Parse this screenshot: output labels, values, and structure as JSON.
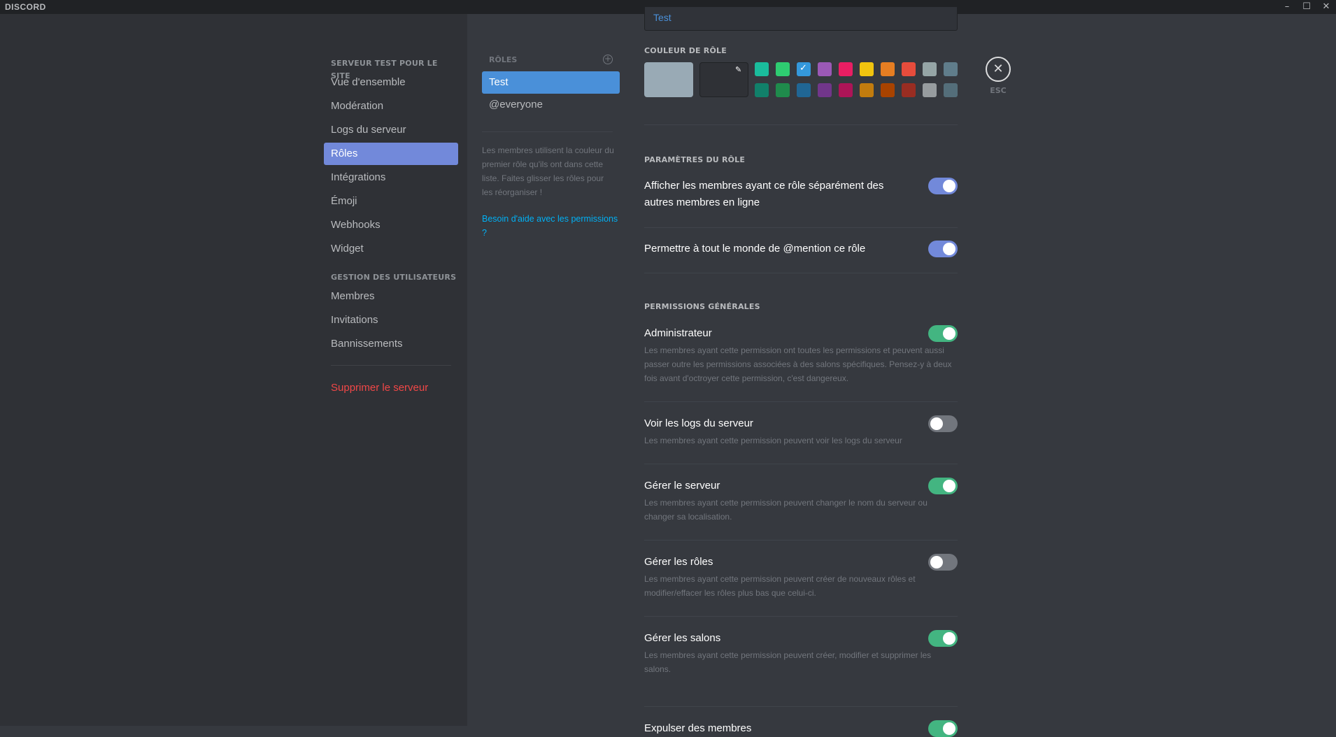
{
  "titlebar": {
    "logo": "DISCORD",
    "min": "–",
    "max": "☐",
    "close": "✕"
  },
  "sidebar": {
    "server_header": "SERVEUR TEST POUR LE SITE",
    "server_items": [
      "Vue d'ensemble",
      "Modération",
      "Logs du serveur",
      "Rôles",
      "Intégrations",
      "Émoji",
      "Webhooks",
      "Widget"
    ],
    "users_header": "GESTION DES UTILISATEURS",
    "user_items": [
      "Membres",
      "Invitations",
      "Bannissements"
    ],
    "delete_label": "Supprimer le serveur"
  },
  "roles": {
    "header": "RÔLES",
    "add_icon": "+",
    "items": [
      "Test",
      "@everyone"
    ],
    "note": "Les membres utilisent la couleur du premier rôle qu'ils ont dans cette liste. Faites glisser les rôles pour les réorganiser !",
    "help_link": "Besoin d'aide avec les permissions ?"
  },
  "main": {
    "role_name": "Test",
    "color_title": "COULEUR DE RÔLE",
    "default_color": "#99aab5",
    "swatch_row_1": [
      "#1abc9c",
      "#2ecc71",
      "#3498db",
      "#9b59b6",
      "#e91e63",
      "#f1c40f",
      "#e67e22",
      "#e74c3c",
      "#95a5a6",
      "#607d8b"
    ],
    "swatch_row_2": [
      "#11806a",
      "#1f8b4c",
      "#206694",
      "#71368a",
      "#ad1457",
      "#c27c0e",
      "#a84300",
      "#992d22",
      "#979c9f",
      "#546e7a"
    ],
    "selected_check": "✓",
    "dropper_icon": "✎",
    "params_title": "PARAMÈTRES DU RÔLE",
    "params": [
      {
        "title": "Afficher les membres ayant ce rôle séparément des autres membres en ligne",
        "state": "blue"
      },
      {
        "title": "Permettre à tout le monde de @mention ce rôle",
        "state": "blue"
      }
    ],
    "perms_title": "PERMISSIONS GÉNÉRALES",
    "perms": [
      {
        "title": "Administrateur",
        "desc": "Les membres ayant cette permission ont toutes les permissions et peuvent aussi passer outre les permissions associées à des salons spécifiques. Pensez-y à deux fois avant d'octroyer cette permission, c'est dangereux.",
        "state": "green"
      },
      {
        "title": "Voir les logs du serveur",
        "desc": "Les membres ayant cette permission peuvent voir les logs du serveur",
        "state": "off"
      },
      {
        "title": "Gérer le serveur",
        "desc": "Les membres ayant cette permission peuvent changer le nom du serveur ou changer sa localisation.",
        "state": "green"
      },
      {
        "title": "Gérer les rôles",
        "desc": "Les membres ayant cette permission peuvent créer de nouveaux rôles et modifier/effacer les rôles plus bas que celui-ci.",
        "state": "off"
      },
      {
        "title": "Gérer les salons",
        "desc": "Les membres ayant cette permission peuvent créer, modifier et supprimer les salons.",
        "state": "green"
      },
      {
        "title": "Expulser des membres",
        "desc": "",
        "state": "green"
      }
    ]
  },
  "close": {
    "icon": "✕",
    "label": "ESC"
  }
}
